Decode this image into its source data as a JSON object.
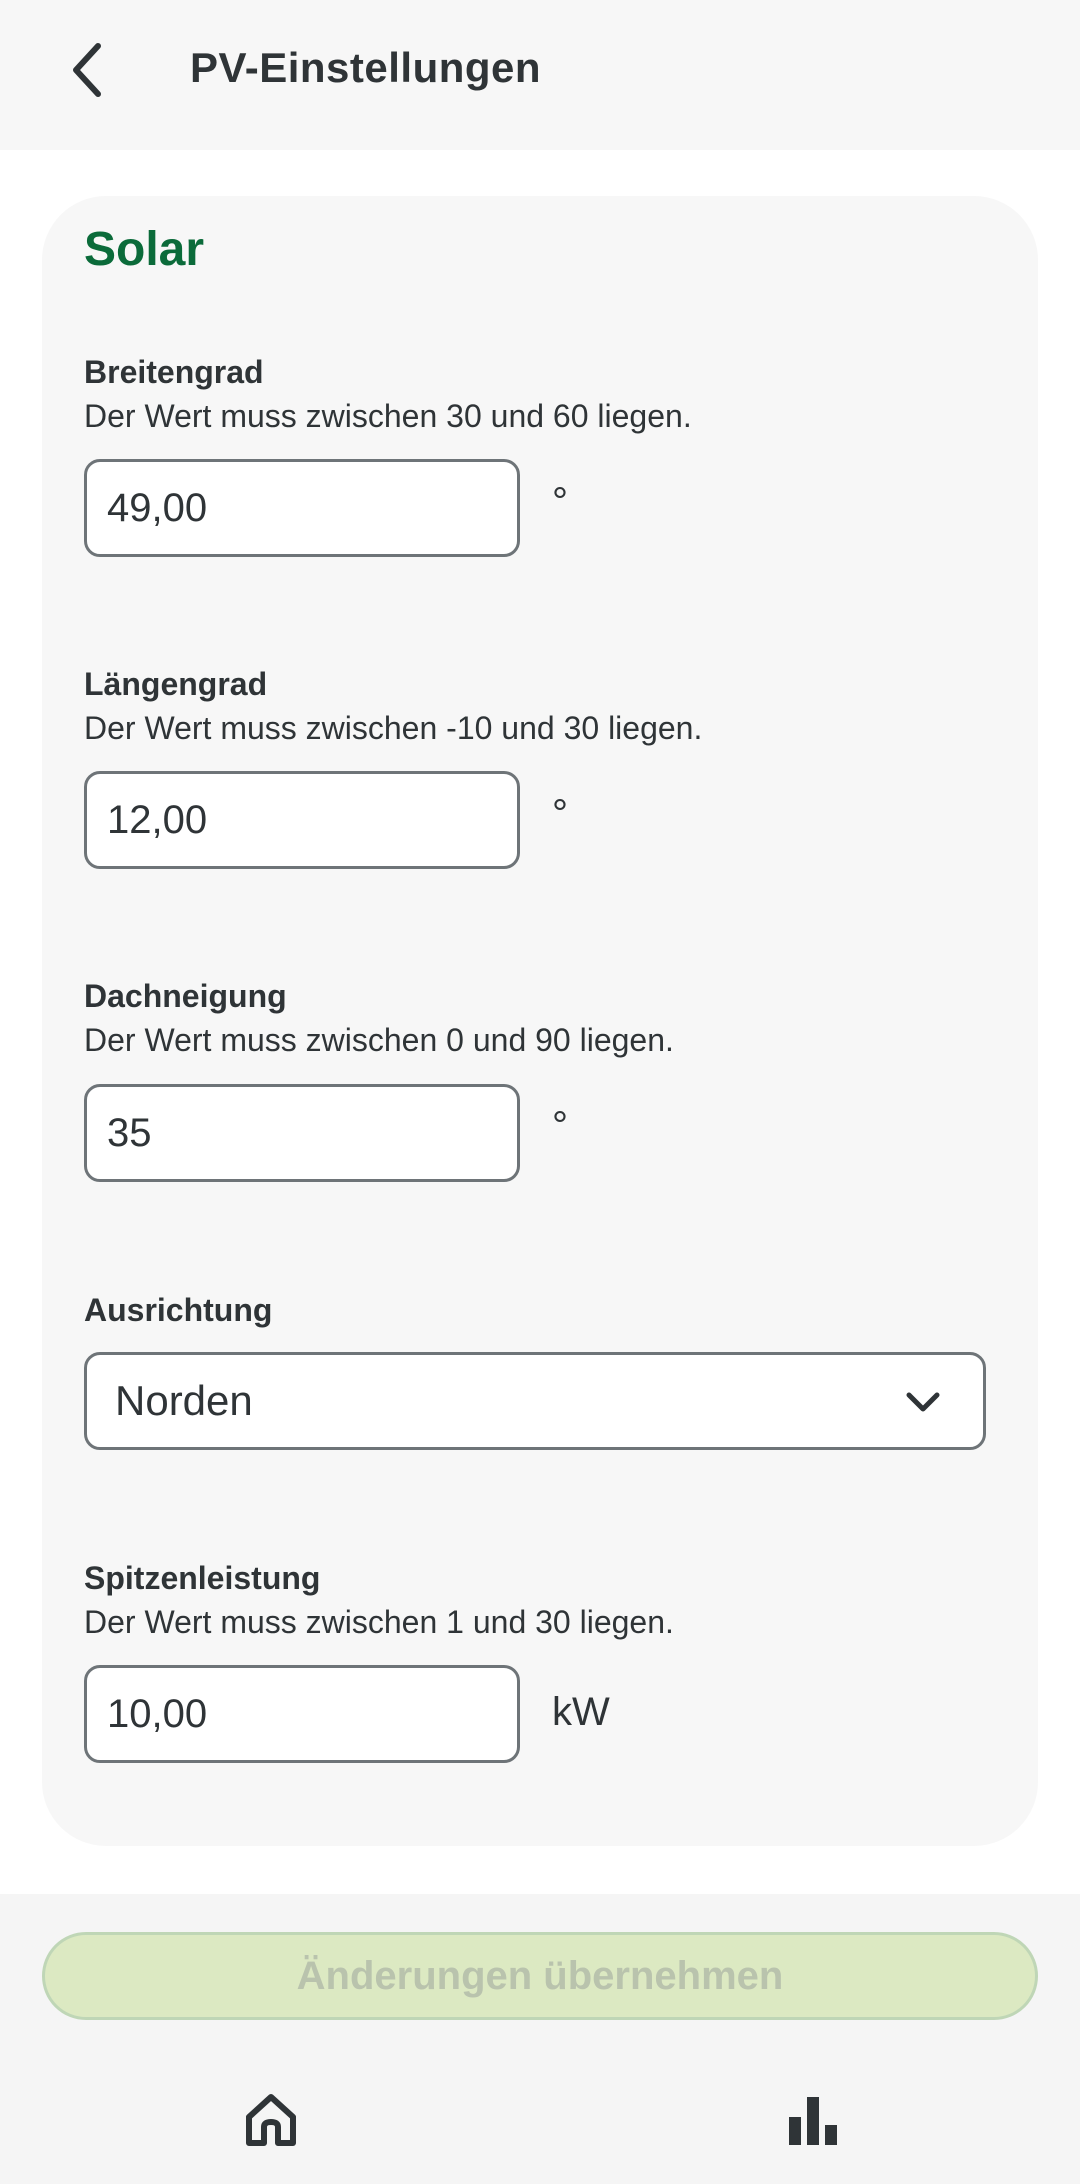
{
  "header": {
    "back_icon": "chevron-left-icon",
    "title": "PV-Einstellungen"
  },
  "card": {
    "title": "Solar",
    "fields": [
      {
        "label": "Breitengrad",
        "hint": "Der Wert muss zwischen 30 und 60 liegen.",
        "value": "49,00",
        "unit": "°"
      },
      {
        "label": "Längengrad",
        "hint": "Der Wert muss zwischen -10 und 30 liegen.",
        "value": "12,00",
        "unit": "°"
      },
      {
        "label": "Dachneigung",
        "hint": "Der Wert muss zwischen 0 und 90 liegen.",
        "value": "35",
        "unit": "°"
      }
    ],
    "orientation": {
      "label": "Ausrichtung",
      "selected": "Norden",
      "icon": "chevron-down-icon"
    },
    "peak": {
      "label": "Spitzenleistung",
      "hint": "Der Wert muss zwischen 1 und 30 liegen.",
      "value": "10,00",
      "unit": "kW"
    }
  },
  "actions": {
    "apply_label": "Änderungen übernehmen"
  },
  "bottom_nav": {
    "items": [
      {
        "icon": "home-icon"
      },
      {
        "icon": "bar-chart-icon"
      }
    ]
  },
  "colors": {
    "accent": "#0b6b3a",
    "text": "#2f3437",
    "button_disabled_bg": "#dce9c2",
    "button_disabled_text": "#b9c3ad"
  }
}
